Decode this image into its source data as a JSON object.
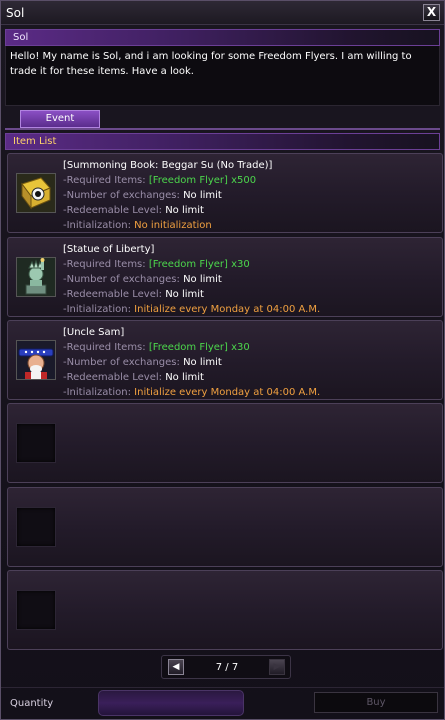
{
  "window": {
    "title": "Sol",
    "close_label": "X"
  },
  "npc": {
    "name": "Sol",
    "dialog": "Hello! My name is Sol, and i am looking for some Freedom Flyers. I am willing to trade it for these items. Have a look."
  },
  "tabs": [
    {
      "label": "Event",
      "selected": true
    }
  ],
  "item_list": {
    "header": "Item List",
    "labels": {
      "required": "-Required Items:",
      "exchanges": "-Number of exchanges:",
      "level": "-Redeemable Level:",
      "init": "-Initialization:"
    },
    "items": [
      {
        "name": "[Summoning Book: Beggar Su (No Trade)]",
        "required": "[Freedom Flyer] x500",
        "exchanges": "No limit",
        "level": "No limit",
        "init": "No initialization",
        "icon": "summoning-book-icon"
      },
      {
        "name": "[Statue of Liberty]",
        "required": "[Freedom Flyer] x30",
        "exchanges": "No limit",
        "level": "No limit",
        "init": "Initialize every Monday at 04:00 A.M.",
        "icon": "statue-of-liberty-icon"
      },
      {
        "name": "[Uncle Sam]",
        "required": "[Freedom Flyer] x30",
        "exchanges": "No limit",
        "level": "No limit",
        "init": "Initialize every Monday at 04:00 A.M.",
        "icon": "uncle-sam-icon"
      }
    ],
    "empty_slots": 3
  },
  "pager": {
    "text": "7 / 7",
    "prev": "◀",
    "next": "▶"
  },
  "footer": {
    "quantity_label": "Quantity",
    "quantity_value": "",
    "buy_label": "Buy"
  },
  "colors": {
    "accent": "#6b3f96",
    "required_value": "#4cd64c",
    "init_value": "#f0a040",
    "label": "#9a8ea8"
  }
}
